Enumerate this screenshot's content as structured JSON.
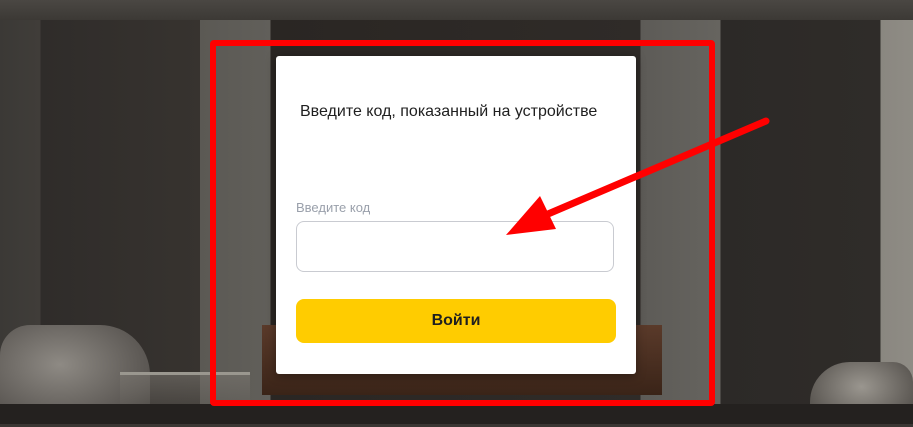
{
  "dialog": {
    "prompt": "Введите код, показанный на устройстве",
    "code_field": {
      "label": "Введите код",
      "value": "",
      "placeholder": ""
    },
    "login_button_label": "Войти"
  },
  "colors": {
    "button_bg": "#ffcc00",
    "annotation": "#ff0000",
    "card_bg": "#ffffff"
  },
  "annotation": {
    "frame_icon": "red-rectangle-highlight",
    "arrow_icon": "red-arrow-pointing-to-input"
  }
}
